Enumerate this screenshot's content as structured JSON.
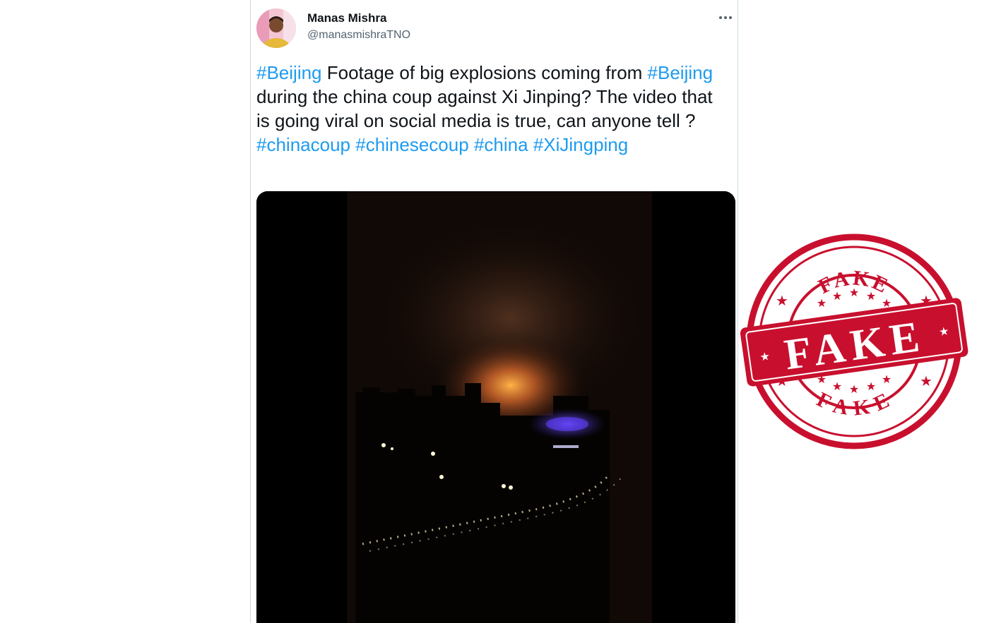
{
  "tweet": {
    "author": {
      "display_name": "Manas Mishra",
      "handle": "@manasmishraTNO"
    },
    "more_icon": "more-horizontal-icon",
    "text_segments": [
      {
        "text": "#Beijing",
        "type": "hashtag"
      },
      {
        "text": " Footage of big explosions coming from ",
        "type": "text"
      },
      {
        "text": "#Beijing",
        "type": "hashtag"
      },
      {
        "text": " during the china coup against Xi Jinping? The video that is going viral on social media is true, can anyone tell ? ",
        "type": "text"
      },
      {
        "text": "#chinacoup",
        "type": "hashtag"
      },
      {
        "text": " ",
        "type": "text"
      },
      {
        "text": "#chinesecoup",
        "type": "hashtag"
      },
      {
        "text": " ",
        "type": "text"
      },
      {
        "text": "#china",
        "type": "hashtag"
      },
      {
        "text": " ",
        "type": "text"
      },
      {
        "text": "#XiJingping",
        "type": "hashtag"
      }
    ]
  },
  "stamp": {
    "top_word": "FAKE",
    "center_word": "FAKE",
    "bottom_word": "FAKE",
    "color": "#c8102e"
  },
  "colors": {
    "hashtag": "#1d9bf0",
    "text": "#0f1419",
    "handle": "#536471"
  }
}
